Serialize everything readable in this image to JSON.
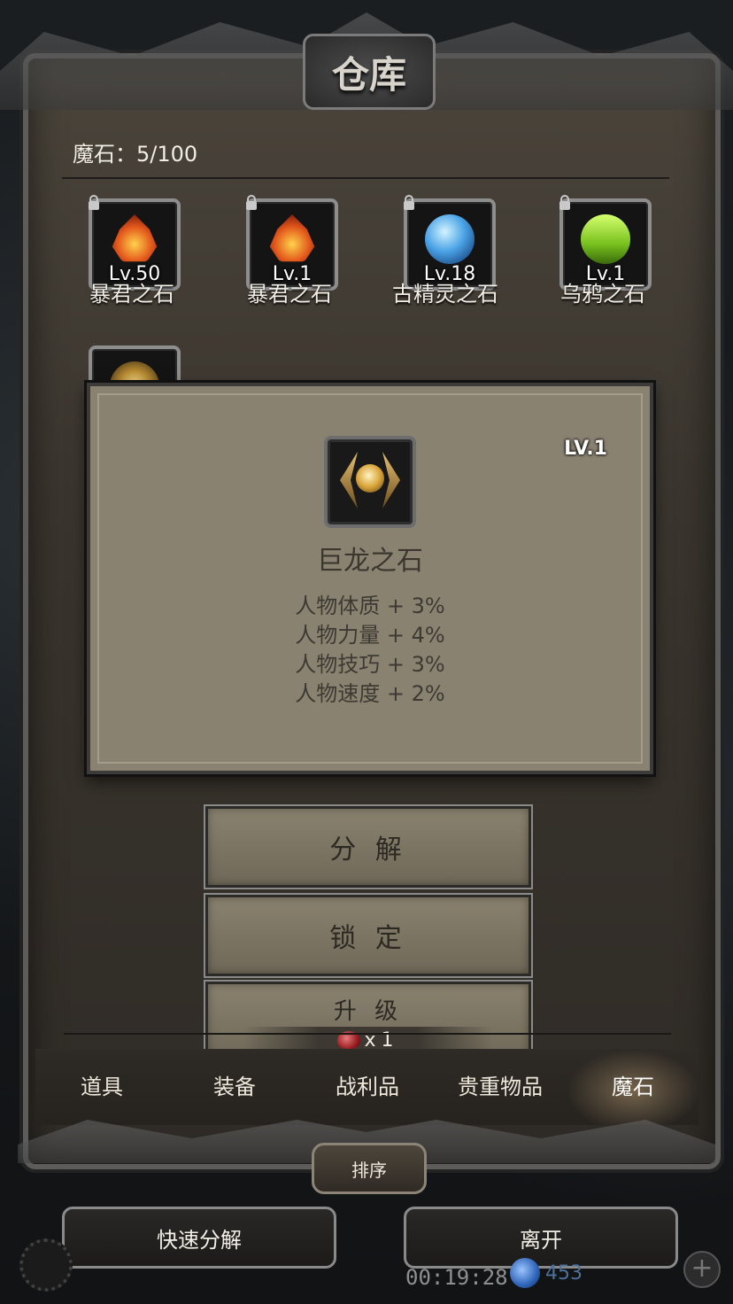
{
  "window": {
    "title": "仓库"
  },
  "capacity": {
    "text": "魔石：5/100"
  },
  "items": [
    {
      "name": "暴君之石",
      "level": "Lv.50",
      "icon": "tyrant-stone-icon",
      "locked": true
    },
    {
      "name": "暴君之石",
      "level": "Lv.1",
      "icon": "tyrant-stone-icon",
      "locked": true
    },
    {
      "name": "古精灵之石",
      "level": "Lv.18",
      "icon": "ancient-elf-stone-icon",
      "locked": true
    },
    {
      "name": "乌鸦之石",
      "level": "Lv.1",
      "icon": "crow-stone-icon",
      "locked": true
    },
    {
      "name": "",
      "level": "",
      "icon": "dragon-stone-icon",
      "locked": true
    }
  ],
  "tooltip": {
    "level": "LV.1",
    "name": "巨龙之石",
    "stats": [
      "人物体质 + 3%",
      "人物力量 + 4%",
      "人物技巧 + 3%",
      "人物速度 + 2%"
    ]
  },
  "actions": {
    "decompose": "分 解",
    "lock": "锁 定",
    "upgrade": "升 级",
    "upgrade_cost": "x1"
  },
  "tabs": [
    {
      "label": "道具",
      "active": false
    },
    {
      "label": "装备",
      "active": false
    },
    {
      "label": "战利品",
      "active": false
    },
    {
      "label": "贵重物品",
      "active": false
    },
    {
      "label": "魔石",
      "active": true
    }
  ],
  "sort": {
    "label": "排序"
  },
  "bottom": {
    "quick_decompose": "快速分解",
    "leave": "离开"
  },
  "hud": {
    "timer": "00:19:28",
    "points": "453"
  },
  "colors": {
    "panel": "#8a8271",
    "frame": "#3a352e",
    "accent_gold": "#d9a53a"
  }
}
